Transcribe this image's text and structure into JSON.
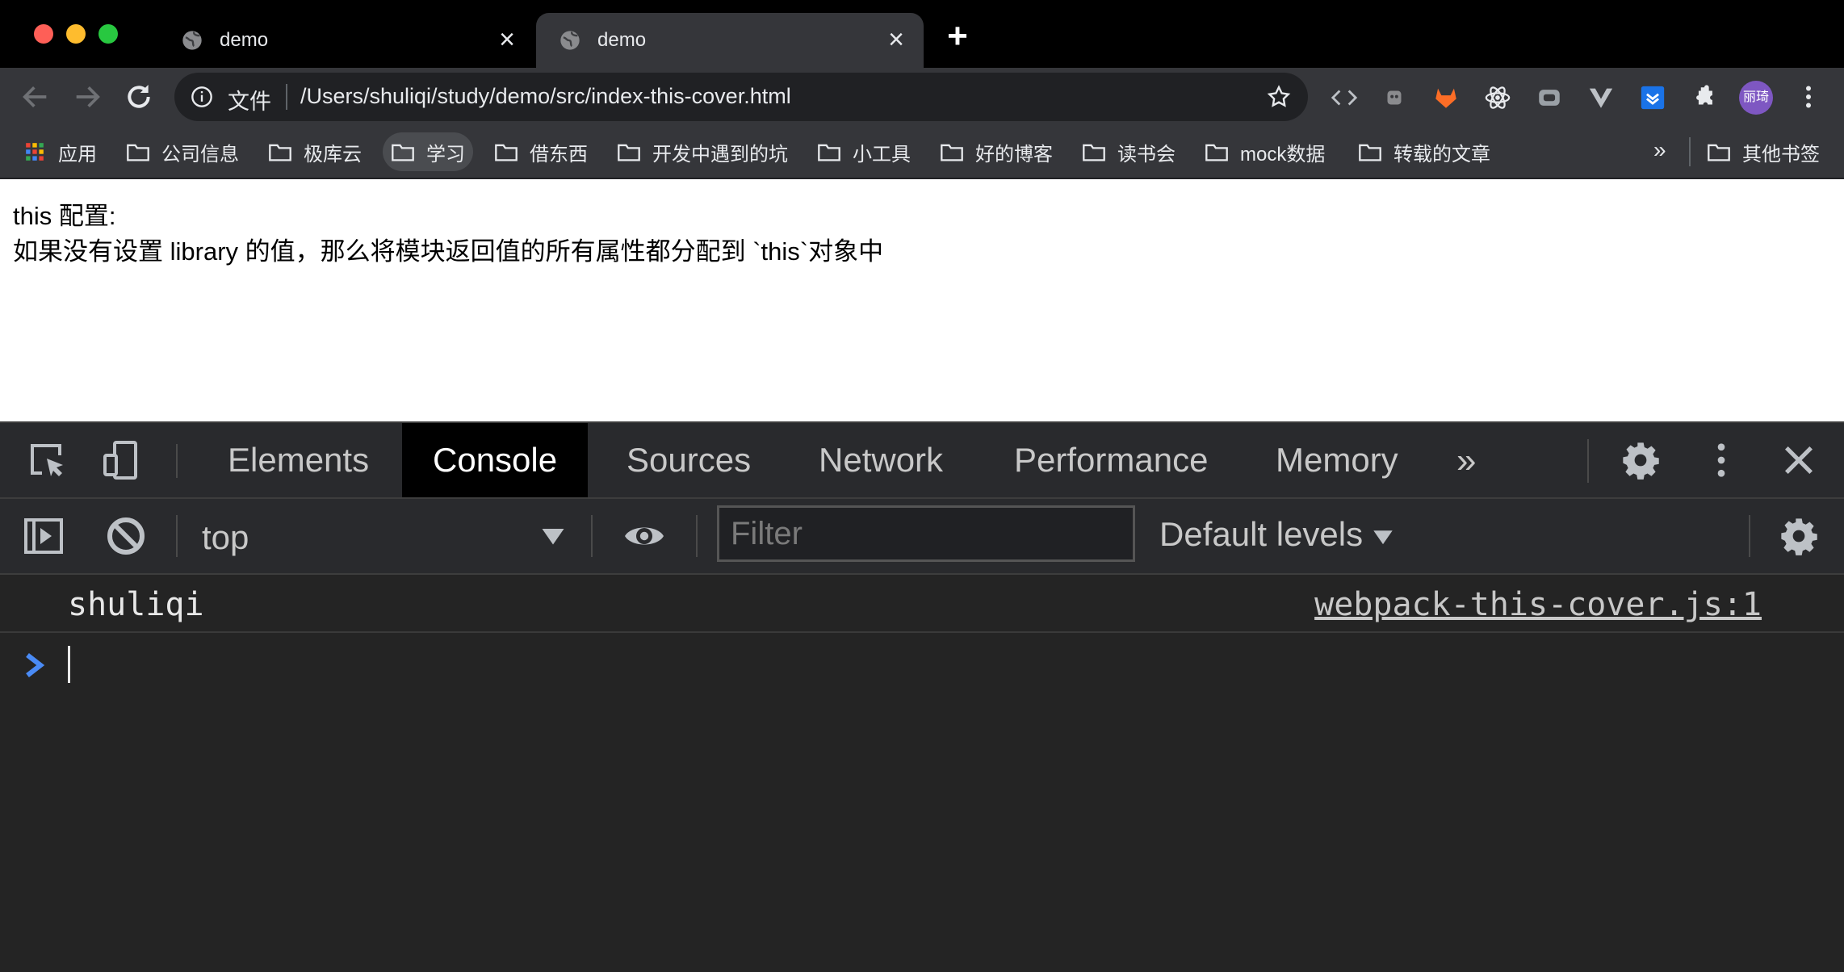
{
  "window": {
    "tabs": [
      {
        "title": "demo"
      },
      {
        "title": "demo"
      }
    ]
  },
  "toolbar": {
    "scheme_label": "文件",
    "url": "/Users/shuliqi/study/demo/src/index-this-cover.html",
    "profile_label": "丽琦"
  },
  "bookmarks": {
    "items": [
      {
        "label": "应用"
      },
      {
        "label": "公司信息"
      },
      {
        "label": "极库云"
      },
      {
        "label": "学习"
      },
      {
        "label": "借东西"
      },
      {
        "label": "开发中遇到的坑"
      },
      {
        "label": "小工具"
      },
      {
        "label": "好的博客"
      },
      {
        "label": "读书会"
      },
      {
        "label": "mock数据"
      },
      {
        "label": "转载的文章"
      }
    ],
    "more_label": "»",
    "other_label": "其他书签"
  },
  "page": {
    "line1": "this 配置:",
    "line2": "如果没有设置 library 的值，那么将模块返回值的所有属性都分配到 `this`对象中"
  },
  "devtools": {
    "tabs": [
      {
        "label": "Elements"
      },
      {
        "label": "Console"
      },
      {
        "label": "Sources"
      },
      {
        "label": "Network"
      },
      {
        "label": "Performance"
      },
      {
        "label": "Memory"
      }
    ],
    "more_label": "»",
    "console": {
      "context": "top",
      "filter_placeholder": "Filter",
      "levels_label": "Default levels",
      "logs": [
        {
          "message": "shuliqi",
          "source": "webpack-this-cover.js:1"
        }
      ]
    }
  },
  "colors": {
    "chrome_dark": "#35363a",
    "omnibox_bg": "#202124",
    "devtools_bg": "#242424",
    "prompt_blue": "#4a8bf5",
    "close_red": "#fe5f57",
    "min_yellow": "#febc2e",
    "max_green": "#28c840"
  }
}
